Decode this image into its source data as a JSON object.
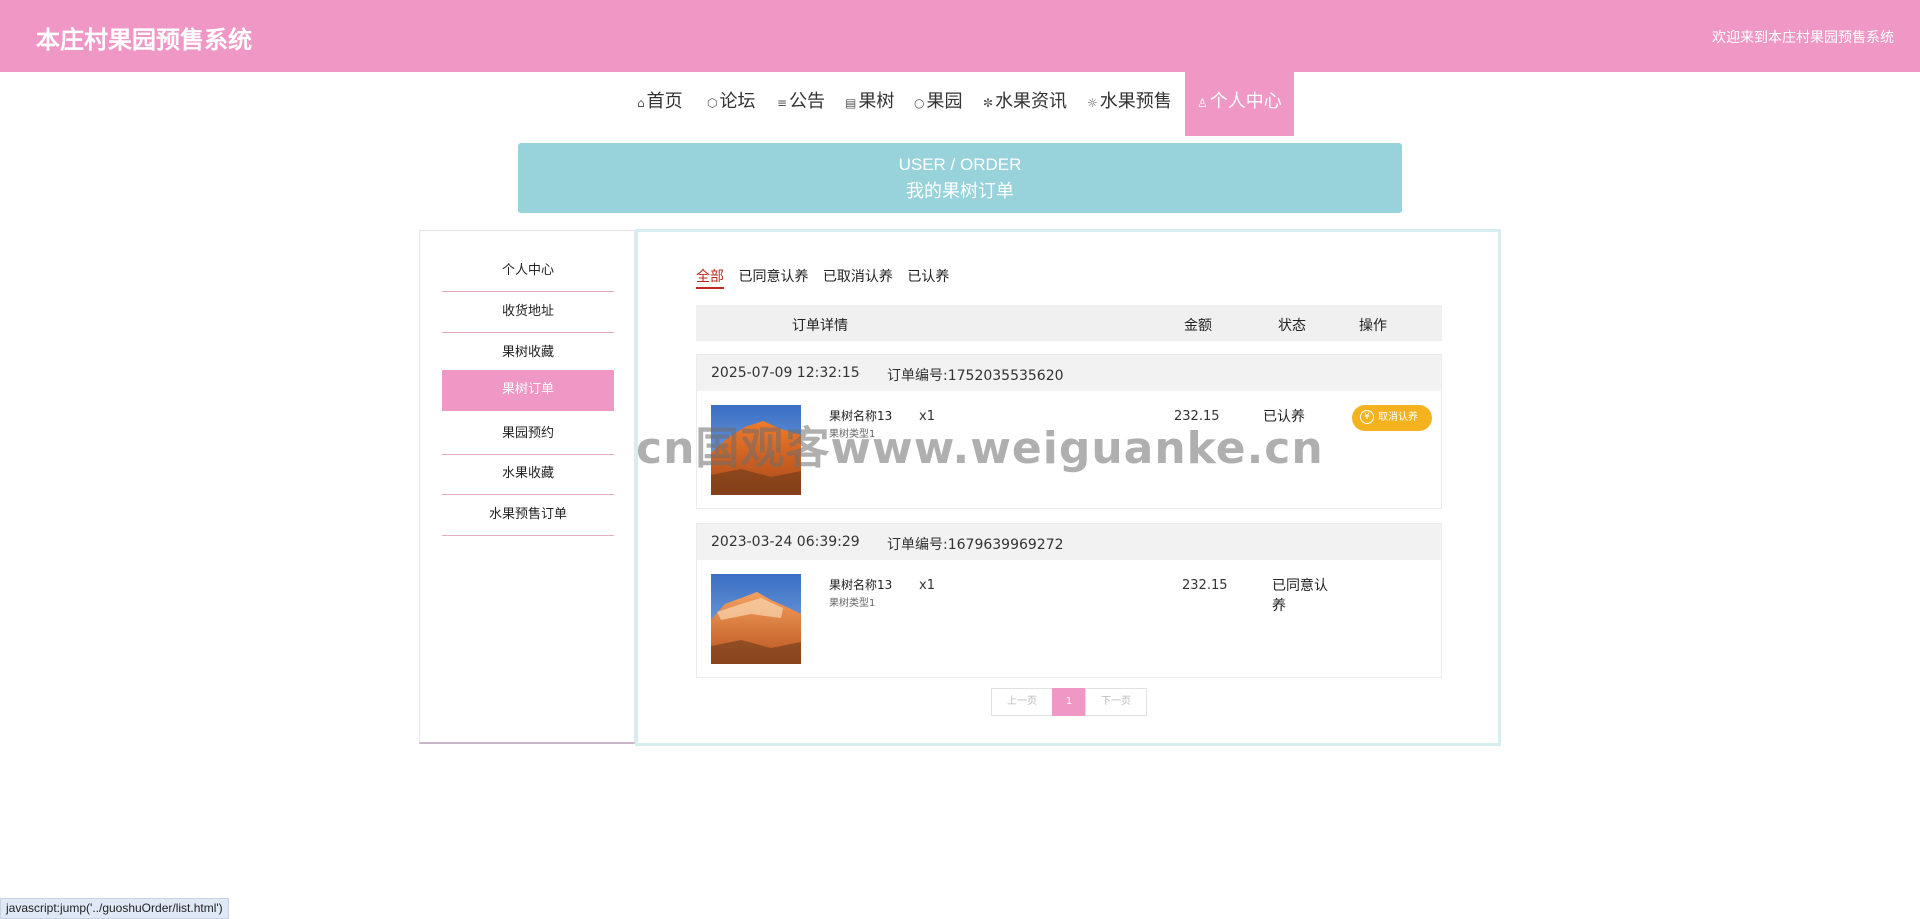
{
  "header": {
    "site_title": "本庄村果园预售系统",
    "welcome": "欢迎来到本庄村果园预售系统"
  },
  "nav": {
    "home": "首页",
    "forum": "论坛",
    "notice": "公告",
    "fruit_tree": "果树",
    "orchard": "果园",
    "fruit_news": "水果资讯",
    "fruit_presale": "水果预售",
    "user_center": "个人中心"
  },
  "banner": {
    "en": "USER / ORDER",
    "cn": "我的果树订单"
  },
  "sidebar": {
    "items": [
      "个人中心",
      "收货地址",
      "果树收藏",
      "果树订单",
      "果园预约",
      "水果收藏",
      "水果预售订单"
    ],
    "active_index": 3
  },
  "tabs": [
    "全部",
    "已同意认养",
    "已取消认养",
    "已认养"
  ],
  "table_header": {
    "detail": "订单详情",
    "amount": "金额",
    "status": "状态",
    "action": "操作"
  },
  "orders": [
    {
      "datetime": "2025-07-09 12:32:15",
      "order_no": "订单编号:1752035535620",
      "product_name": "果树名称13",
      "product_type": "果树类型1",
      "qty": "x1",
      "amount": "232.15",
      "status": "已认养",
      "action": "取消认养"
    },
    {
      "datetime": "2023-03-24 06:39:29",
      "order_no": "订单编号:1679639969272",
      "product_name": "果树名称13",
      "product_type": "果树类型1",
      "qty": "x1",
      "amount": "232.15",
      "status": "已同意认养",
      "action": ""
    }
  ],
  "pager": {
    "prev": "上一页",
    "current": "1",
    "next": "下一页"
  },
  "watermark": "cn国观客www.weiguanke.cn",
  "statusbar": "javascript:jump('../guoshuOrder/list.html')",
  "colors": {
    "header_pink": "#ef98c6",
    "banner_blue": "#98d2da",
    "active_tab_red": "#c0281f",
    "cancel_button_orange": "#f4b31e"
  }
}
